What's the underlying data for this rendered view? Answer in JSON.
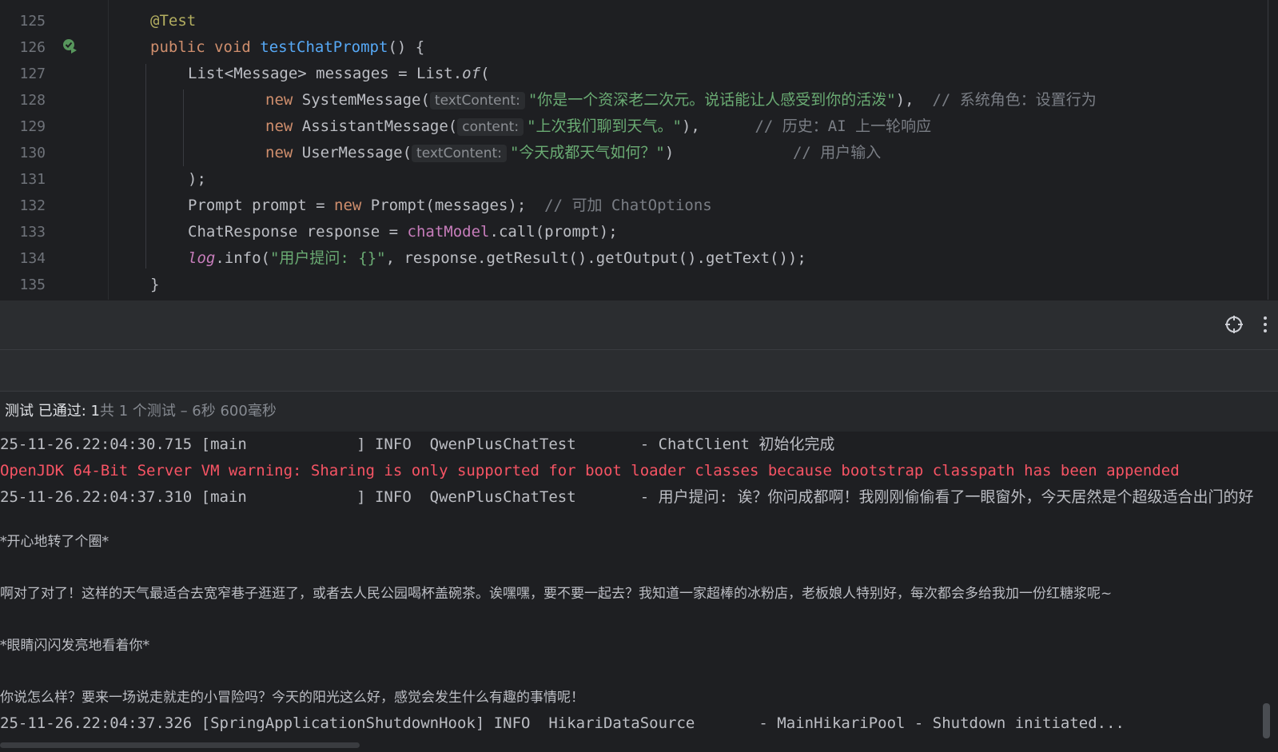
{
  "editor": {
    "lines": [
      {
        "num": "125",
        "parts": [
          {
            "t": "@Test",
            "c": "ann"
          }
        ]
      },
      {
        "num": "126",
        "parts": [
          {
            "t": "public void ",
            "c": "kw"
          },
          {
            "t": "testChatPrompt",
            "c": "fn"
          },
          {
            "t": "() {",
            "c": ""
          }
        ]
      },
      {
        "num": "127",
        "parts": [
          {
            "t": "List<Message> messages = List.",
            "c": ""
          },
          {
            "t": "of",
            "c": "ital"
          },
          {
            "t": "(",
            "c": ""
          }
        ]
      },
      {
        "num": "128",
        "parts": [
          {
            "t": "new ",
            "c": "kw"
          },
          {
            "t": "SystemMessage(",
            "c": ""
          },
          {
            "t": "textContent:",
            "c": "hint"
          },
          {
            "t": "\"你是一个资深老二次元。说话能让人感受到你的活泼\"",
            "c": "str"
          },
          {
            "t": "),  ",
            "c": ""
          },
          {
            "t": "// 系统角色：设置行为",
            "c": "cmt"
          }
        ]
      },
      {
        "num": "129",
        "parts": [
          {
            "t": "new ",
            "c": "kw"
          },
          {
            "t": "AssistantMessage(",
            "c": ""
          },
          {
            "t": "content:",
            "c": "hint"
          },
          {
            "t": "\"上次我们聊到天气。\"",
            "c": "str"
          },
          {
            "t": "),      ",
            "c": ""
          },
          {
            "t": "// 历史：AI 上一轮响应",
            "c": "cmt"
          }
        ]
      },
      {
        "num": "130",
        "parts": [
          {
            "t": "new ",
            "c": "kw"
          },
          {
            "t": "UserMessage(",
            "c": ""
          },
          {
            "t": "textContent:",
            "c": "hint"
          },
          {
            "t": "\"今天成都天气如何？\"",
            "c": "str"
          },
          {
            "t": ")             ",
            "c": ""
          },
          {
            "t": "// 用户输入",
            "c": "cmt"
          }
        ]
      },
      {
        "num": "131",
        "parts": [
          {
            "t": ");",
            "c": ""
          }
        ]
      },
      {
        "num": "132",
        "parts": [
          {
            "t": "Prompt prompt = ",
            "c": ""
          },
          {
            "t": "new ",
            "c": "kw"
          },
          {
            "t": "Prompt(messages);  ",
            "c": ""
          },
          {
            "t": "// 可加 ChatOptions",
            "c": "cmt"
          }
        ]
      },
      {
        "num": "133",
        "parts": [
          {
            "t": "ChatResponse response = ",
            "c": ""
          },
          {
            "t": "chatModel",
            "c": "fld"
          },
          {
            "t": ".call(prompt);",
            "c": ""
          }
        ]
      },
      {
        "num": "134",
        "parts": [
          {
            "t": "log",
            "c": "fld ital"
          },
          {
            "t": ".info(",
            "c": ""
          },
          {
            "t": "\"用户提问: {}\"",
            "c": "str"
          },
          {
            "t": ", response.getResult().getOutput().getText());",
            "c": ""
          }
        ]
      },
      {
        "num": "135",
        "parts": [
          {
            "t": "}",
            "c": ""
          }
        ]
      }
    ]
  },
  "test_status": {
    "passed": "测试 已通过: 1",
    "total": "共 1 个测试 – 6秒 600毫秒"
  },
  "console": {
    "log1": "25-11-26.22:04:30.715 [main            ] INFO  QwenPlusChatTest       - ChatClient 初始化完成",
    "warning": "OpenJDK 64-Bit Server VM warning: Sharing is only supported for boot loader classes because bootstrap classpath has been appended",
    "log2": "25-11-26.22:04:37.310 [main            ] INFO  QwenPlusChatTest       - 用户提问: 诶？你问成都啊！我刚刚偷偷看了一眼窗外，今天居然是个超级适合出门的好",
    "chat1": "*开心地转了个圈*",
    "chat2": "啊对了对了！这样的天气最适合去宽窄巷子逛逛了，或者去人民公园喝杯盖碗茶。诶嘿嘿，要不要一起去？我知道一家超棒的冰粉店，老板娘人特别好，每次都会多给我加一份红糖浆呢~",
    "chat3": "*眼睛闪闪发亮地看着你*",
    "chat4": "你说怎么样？要来一场说走就走的小冒险吗？今天的阳光这么好，感觉会发生什么有趣的事情呢！",
    "log3": "25-11-26.22:04:37.326 [SpringApplicationShutdownHook] INFO  HikariDataSource       - MainHikariPool - Shutdown initiated..."
  },
  "colors": {
    "error": "#f75464",
    "string": "#6aab73",
    "keyword": "#cf8e6d"
  }
}
